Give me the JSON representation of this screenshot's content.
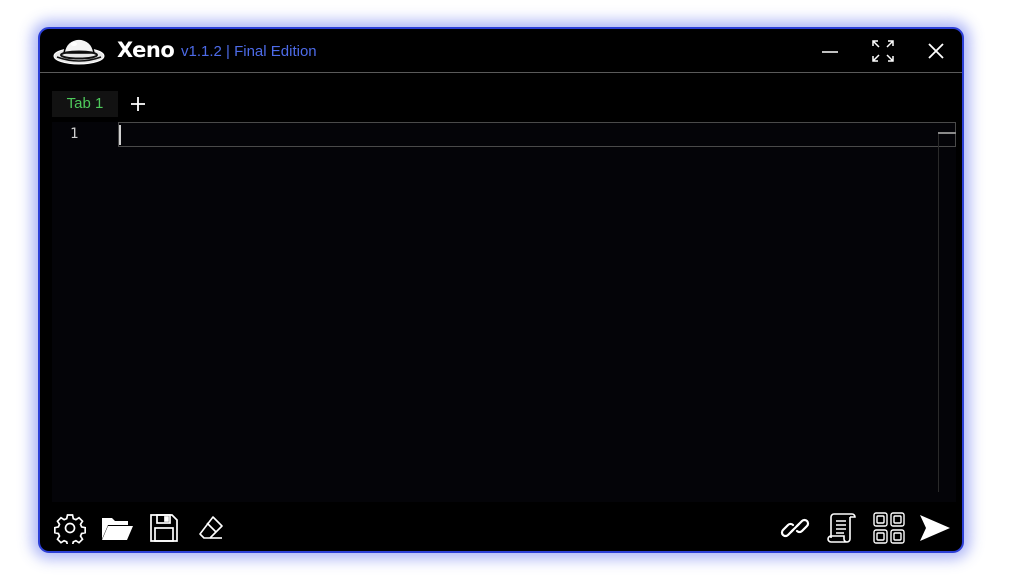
{
  "window": {
    "app_name": "Xeno",
    "version_label": "v1.1.2 | Final Edition",
    "colors": {
      "background": "#000000",
      "border": "#2c3fd6",
      "version_text": "#4d6be8",
      "tab_text": "#4ec95b"
    },
    "controls": [
      "minimize-icon",
      "maximize-icon",
      "close-icon"
    ]
  },
  "tabs": [
    {
      "label": "Tab 1",
      "active": true
    }
  ],
  "editor": {
    "line_numbers": [
      "1"
    ],
    "lines": [
      ""
    ]
  },
  "toolbar": {
    "left_icons": [
      "gear-icon",
      "folder-open-icon",
      "save-icon",
      "eraser-icon"
    ],
    "right_icons": [
      "link-icon",
      "script-icon",
      "grid-icon",
      "send-icon"
    ]
  }
}
